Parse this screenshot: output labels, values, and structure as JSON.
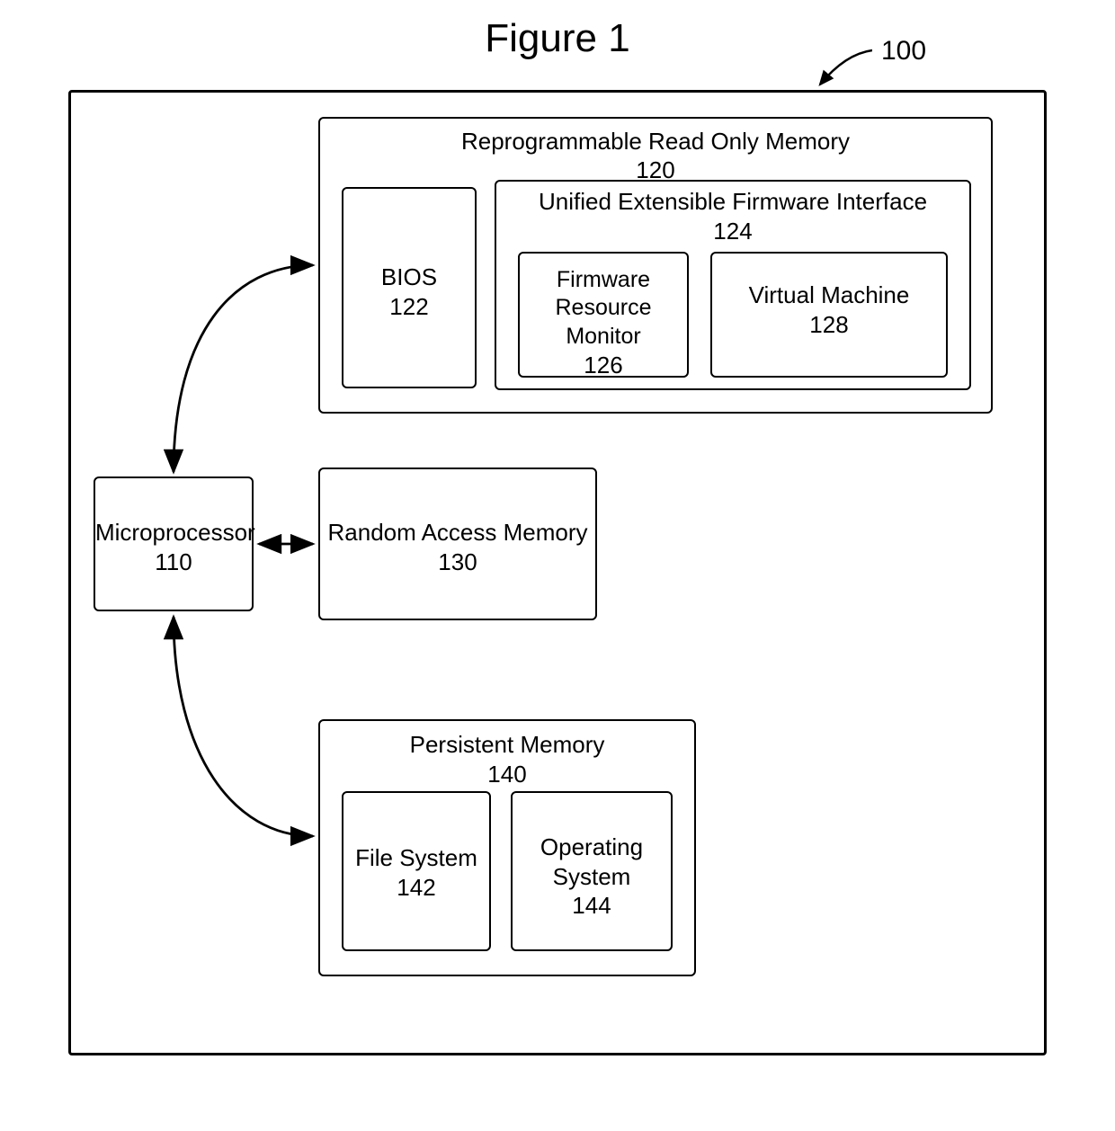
{
  "figure": {
    "title": "Figure 1",
    "ref": "100"
  },
  "blocks": {
    "microprocessor": {
      "name": "Microprocessor",
      "num": "110"
    },
    "rom": {
      "name": "Reprogrammable Read Only Memory",
      "num": "120"
    },
    "bios": {
      "name": "BIOS",
      "num": "122"
    },
    "uefi": {
      "name": "Unified Extensible Firmware Interface",
      "num": "124"
    },
    "frm": {
      "name": "Firmware Resource Monitor",
      "num": "126"
    },
    "vm": {
      "name": "Virtual Machine",
      "num": "128"
    },
    "ram": {
      "name": "Random Access Memory",
      "num": "130"
    },
    "pm": {
      "name": "Persistent Memory",
      "num": "140"
    },
    "fs": {
      "name": "File System",
      "num": "142"
    },
    "os": {
      "name": "Operating System",
      "num": "144"
    }
  },
  "connections": [
    {
      "from": "microprocessor",
      "to": "rom",
      "style": "curved-bidirectional"
    },
    {
      "from": "microprocessor",
      "to": "ram",
      "style": "straight-bidirectional"
    },
    {
      "from": "microprocessor",
      "to": "pm",
      "style": "curved-bidirectional"
    }
  ]
}
